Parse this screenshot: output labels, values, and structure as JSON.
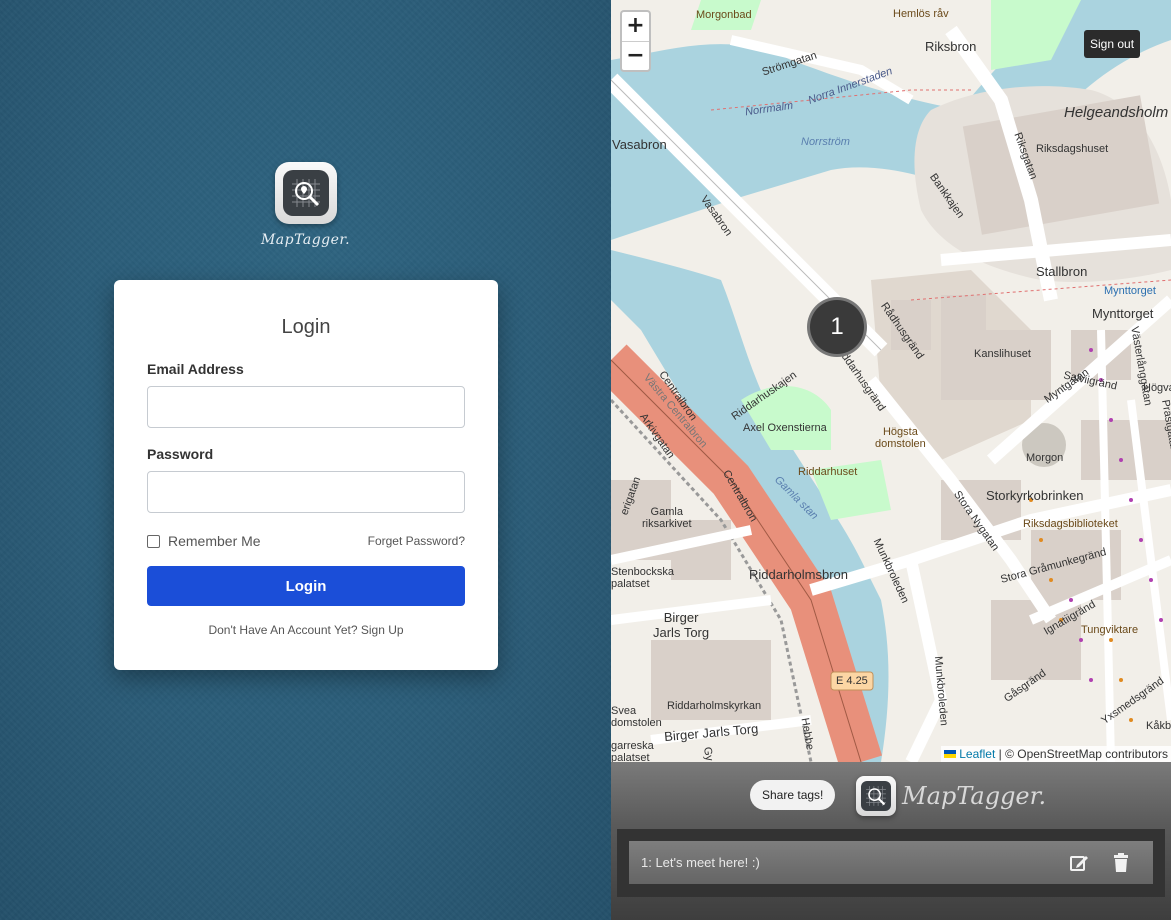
{
  "brand": {
    "name": "MapTagger."
  },
  "login": {
    "title": "Login",
    "email_label": "Email Address",
    "email_value": "",
    "password_label": "Password",
    "password_value": "",
    "remember_label": "Remember Me",
    "remember_checked": false,
    "forgot_label": "Forget Password?",
    "submit_label": "Login",
    "signup_text": "Don't Have An Account Yet? Sign Up"
  },
  "map": {
    "zoom_in": "+",
    "zoom_out": "−",
    "sign_out": "Sign out",
    "cluster_count": "1",
    "attribution_leaflet": "Leaflet",
    "attribution_rest": " | © OpenStreetMap contributors",
    "labels": {
      "morgonbad": "Morgonbad",
      "stromgatan": "Strömgatan",
      "hemlos_rav": "Hemlös råv",
      "riksbron": "Riksbron",
      "norrmalm": "Norrmalm",
      "norra_innerstaden": "Norra Innerstaden",
      "norrstrom": "Norrström",
      "vasabron": "Vasabron",
      "vasabron_road": "Vasabron",
      "helgeandsholmen": "Helgeandsholm",
      "riksdagshuset": "Riksdagshuset",
      "riksgatan": "Riksgatan",
      "bankkajen": "Bankkajen",
      "stallbron": "Stallbron",
      "mynttorget_stop": "Mynttorget",
      "mynttorget": "Mynttorget",
      "radhusgrand": "Rådhusgränd",
      "kanslihuset": "Kanslihuset",
      "riddarhuskajen": "Riddarhuskajen",
      "riddarhusgrand": "Riddarhusgränd",
      "axel_oxenstierna": "Axel Oxenstierna",
      "hogsta_domstolen": "Högsta\ndomstolen",
      "riddarhuset": "Riddarhuset",
      "morgon": "Morgon",
      "storkyrkobrinken": "Storkyrkobrinken",
      "riksdagsbiblioteket": "Riksdagsbiblioteket",
      "hogvakt": "Högvak",
      "myntgatan": "Myntgatan",
      "salviigrand": "Salviigränd",
      "vasterlanggatan": "Västerlånggatan",
      "prastgatan": "Prästgatan",
      "centralbron": "Centralbron",
      "arkivgatan": "Arkivgatan",
      "gamla_riksarkivet": "Gamla\nriksarkivet",
      "stenbockska_palatset": "Stenbockska\npalatset",
      "riddarholmsbron": "Riddarholmsbron",
      "birger_jarls_torg": "Birger\nJarls Torg",
      "riddarholmskyrkan": "Riddarholmskyrkan",
      "birger_jarls_torg_road": "Birger Jarls Torg",
      "munkbroleden": "Munkbroleden",
      "stora_nygatan": "Stora Nygatan",
      "stora_gramunkegrand": "Stora Gråmunkegränd",
      "ignatiigrand": "Ignatiigränd",
      "tungviktare": "Tungviktare",
      "gasgrand": "Gåsgränd",
      "yxsmedsgrand": "Yxsmedsgränd",
      "e425": "E 4.25",
      "gamla_stan": "Gamla stan",
      "vasagatan": "Västra Centralbron",
      "svea_hovratt": "Svea\ndomstolen",
      "wrangelska": "garreska\npalatset",
      "kakbrinken": "Kåkb",
      "jarnvag": "Hebbe",
      "gy": "Gy",
      "varfrugatan": "erigatan"
    }
  },
  "bottom": {
    "share_label": "Share tags!",
    "brand": "MapTagger.",
    "tags": [
      {
        "text": "1: Let's meet here! :)"
      }
    ]
  },
  "colors": {
    "accent": "#1b4ed8",
    "background": "#2c5a75",
    "water": "#aad3df",
    "motorway": "#e8907b"
  }
}
